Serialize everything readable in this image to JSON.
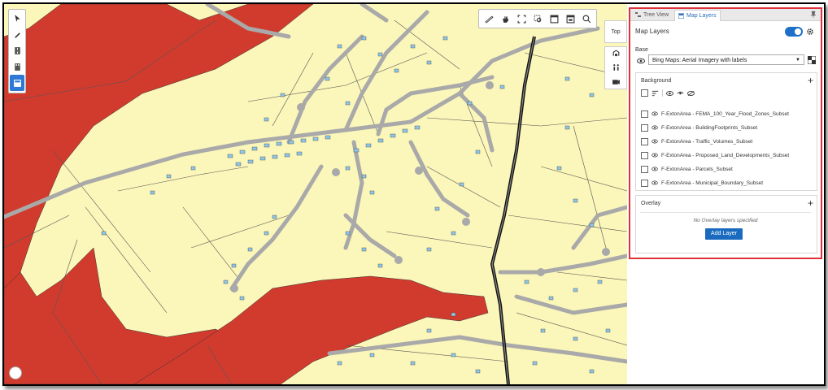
{
  "tabs": [
    {
      "label": "Tree View",
      "icon": "tree-icon"
    },
    {
      "label": "Map Layers",
      "icon": "layers-icon"
    }
  ],
  "panel": {
    "title": "Map Layers",
    "visible_toggle": true,
    "base_label": "Base",
    "basemap_selected": "Bing Maps: Aerial Imagery with labels",
    "background": {
      "label": "Background",
      "layers": [
        "F-ExtonArea - FEMA_100_Year_Flood_Zones_Subset",
        "F-ExtonArea - BuildingFootprints_Subset",
        "F-ExtonArea - Traffic_Volumes_Subset",
        "F-ExtonArea - Proposed_Land_Developments_Subset",
        "F-ExtonArea - Parcels_Subset",
        "F-ExtonArea - Municipal_Boundary_Subset"
      ]
    },
    "overlay": {
      "label": "Overlay",
      "empty_text": "No Overlay layers specified",
      "add_button": "Add Layer"
    }
  },
  "map": {
    "view_button": "Top",
    "colors": {
      "land": "#fbf6b9",
      "flood_zone": "#d13b2e",
      "parcel_line": "#4a4a4a",
      "road": "#c8c8c8",
      "building": "#8ec6e8",
      "accent": "#1e6fc7",
      "highlight": "#e0303a"
    }
  }
}
